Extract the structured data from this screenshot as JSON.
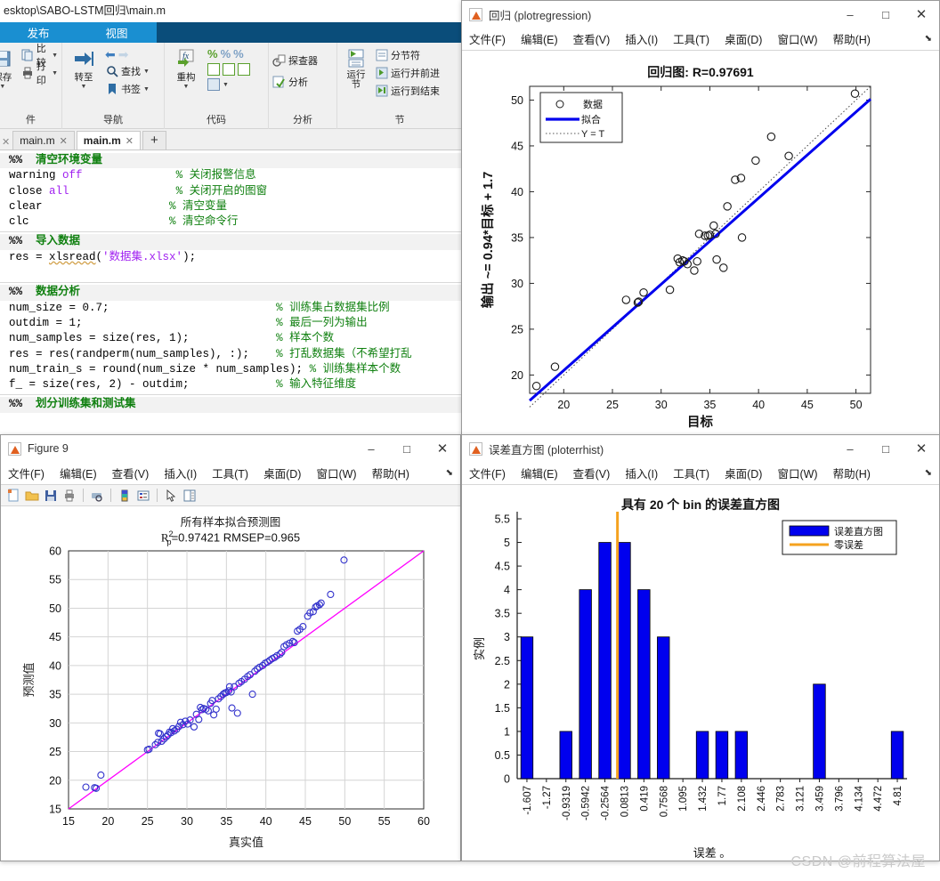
{
  "editor": {
    "path_title": "esktop\\SABO-LSTM回归\\main.m",
    "ribbon_tabs": [
      {
        "label": "发布"
      },
      {
        "label": "视图"
      }
    ],
    "ribbon_groups": [
      {
        "label": "件",
        "items": [
          "保存",
          "比较",
          "打印"
        ]
      },
      {
        "label": "导航",
        "items": [
          "转至",
          "查找",
          "书签"
        ]
      },
      {
        "label": "代码",
        "items": [
          "重构",
          "%",
          "%%",
          "%%↵"
        ]
      },
      {
        "label": "分析",
        "items": [
          "探查器",
          "分析"
        ]
      },
      {
        "label": "节",
        "items": [
          "运行节",
          "分节符",
          "运行并前进",
          "运行到结束"
        ]
      }
    ],
    "group_labels": {
      "file": "件",
      "nav": "导航",
      "code": "代码",
      "analyze": "分析",
      "section": "节"
    },
    "buttons": {
      "compare": "比较",
      "print": "打印",
      "goto": "转至",
      "find": "查找",
      "bookmark": "书签",
      "refactor": "重构",
      "profiler": "探查器",
      "analyze": "分析",
      "run_section": "运行\n节",
      "section_break": "分节符",
      "run_advance": "运行并前进",
      "run_to_end": "运行到结束"
    },
    "tabs": [
      {
        "label": "main.m",
        "active": false
      },
      {
        "label": "main.m",
        "active": true
      }
    ],
    "new_tab_label": "+",
    "code_lines": [
      {
        "type": "section",
        "text": "%%  清空环境变量"
      },
      {
        "type": "code",
        "code": "warning off",
        "comment": "% 关闭报警信息"
      },
      {
        "type": "code",
        "code": "close all",
        "comment": "% 关闭开启的图窗"
      },
      {
        "type": "code",
        "code": "clear",
        "comment": "% 清空变量"
      },
      {
        "type": "code",
        "code": "clc",
        "comment": "% 清空命令行"
      },
      {
        "type": "section",
        "text": "%%  导入数据"
      },
      {
        "type": "code",
        "code": "res = xlsread('数据集.xlsx');",
        "comment": ""
      },
      {
        "type": "blank"
      },
      {
        "type": "section",
        "text": "%%  数据分析"
      },
      {
        "type": "code",
        "code": "num_size = 0.7;",
        "comment": "% 训练集占数据集比例"
      },
      {
        "type": "code",
        "code": "outdim = 1;",
        "comment": "% 最后一列为输出"
      },
      {
        "type": "code",
        "code": "num_samples = size(res, 1);",
        "comment": "% 样本个数"
      },
      {
        "type": "code",
        "code": "res = res(randperm(num_samples), :);",
        "comment": "% 打乱数据集（不希望打乱"
      },
      {
        "type": "code",
        "code": "num_train_s = round(num_size * num_samples);",
        "comment": "% 训练集样本个数"
      },
      {
        "type": "code",
        "code": "f_ = size(res, 2) - outdim;",
        "comment": "% 输入特征维度"
      },
      {
        "type": "section",
        "text": "%%  划分训练集和测试集"
      }
    ]
  },
  "regression_window": {
    "title": "回归 (plotregression)",
    "menu": [
      {
        "label": "文件(F)"
      },
      {
        "label": "编辑(E)"
      },
      {
        "label": "查看(V)"
      },
      {
        "label": "插入(I)"
      },
      {
        "label": "工具(T)"
      },
      {
        "label": "桌面(D)"
      },
      {
        "label": "窗口(W)"
      },
      {
        "label": "帮助(H)"
      }
    ],
    "window_buttons": {
      "minimize": "–",
      "maximize": "□",
      "close": "✕"
    }
  },
  "figure9_window": {
    "title": "Figure 9",
    "menu": [
      {
        "label": "文件(F)"
      },
      {
        "label": "编辑(E)"
      },
      {
        "label": "查看(V)"
      },
      {
        "label": "插入(I)"
      },
      {
        "label": "工具(T)"
      },
      {
        "label": "桌面(D)"
      },
      {
        "label": "窗口(W)"
      },
      {
        "label": "帮助(H)"
      }
    ],
    "toolbar_icons": [
      "new-figure-icon",
      "open-file-icon",
      "save-icon",
      "print-icon",
      "print-preview-icon",
      "colorbar-icon",
      "legend-icon",
      "pointer-icon",
      "plot-browser-icon"
    ],
    "window_buttons": {
      "minimize": "–",
      "maximize": "□",
      "close": "✕"
    }
  },
  "errorhist_window": {
    "title": "误差直方图 (ploterrhist)",
    "menu": [
      {
        "label": "文件(F)"
      },
      {
        "label": "编辑(E)"
      },
      {
        "label": "查看(V)"
      },
      {
        "label": "插入(I)"
      },
      {
        "label": "工具(T)"
      },
      {
        "label": "桌面(D)"
      },
      {
        "label": "窗口(W)"
      },
      {
        "label": "帮助(H)"
      }
    ],
    "window_buttons": {
      "minimize": "–",
      "maximize": "□",
      "close": "✕"
    }
  },
  "watermark": "CSDN @前程算法屋",
  "chart_data": [
    {
      "id": "regression-plot",
      "type": "scatter",
      "title": "回归图: R=0.97691",
      "xlabel": "目标",
      "ylabel": "输出 ~= 0.94*目标 + 1.7",
      "xlim": [
        16.5,
        51.5
      ],
      "ylim": [
        18.0,
        51.5
      ],
      "xticks": [
        20,
        25,
        30,
        35,
        40,
        45,
        50
      ],
      "yticks": [
        20,
        25,
        30,
        35,
        40,
        45,
        50
      ],
      "grid": false,
      "legend": [
        {
          "label": "数据",
          "marker": "circle",
          "color": "#000000"
        },
        {
          "label": "拟合",
          "marker": "line",
          "color": "#0000ee"
        },
        {
          "label": "Y = T",
          "marker": "dotted",
          "color": "#555555"
        }
      ],
      "legend_position": "top-left",
      "fit_line": {
        "slope": 0.94,
        "intercept": 1.7,
        "color": "#0000ee"
      },
      "identity_line": {
        "slope": 1,
        "intercept": 0,
        "color": "#444444"
      },
      "points": [
        [
          17.2,
          18.8
        ],
        [
          19.1,
          20.9
        ],
        [
          26.4,
          28.2
        ],
        [
          27.6,
          27.9
        ],
        [
          27.7,
          28.0
        ],
        [
          28.2,
          29.0
        ],
        [
          30.9,
          29.3
        ],
        [
          31.7,
          32.7
        ],
        [
          31.9,
          32.3
        ],
        [
          32.4,
          32.4
        ],
        [
          32.7,
          32.1
        ],
        [
          33.4,
          31.4
        ],
        [
          33.7,
          32.4
        ],
        [
          34.8,
          35.2
        ],
        [
          35.0,
          35.3
        ],
        [
          35.4,
          36.3
        ],
        [
          35.6,
          35.4
        ],
        [
          35.7,
          32.6
        ],
        [
          36.4,
          31.7
        ],
        [
          38.3,
          35.0
        ],
        [
          36.8,
          38.4
        ],
        [
          37.6,
          41.3
        ],
        [
          38.2,
          41.5
        ],
        [
          39.7,
          43.4
        ],
        [
          41.3,
          46.0
        ],
        [
          43.1,
          43.9
        ],
        [
          49.9,
          50.7
        ],
        [
          33.9,
          35.4
        ],
        [
          34.5,
          35.2
        ],
        [
          32.2,
          32.5
        ]
      ]
    },
    {
      "id": "all-samples-fit-plot",
      "type": "scatter",
      "title": "所有样本拟合预测图",
      "subtitle": "R²p=0.97421  RMSEP=0.965",
      "subtitle_r2": "R",
      "subtitle_sup": "2",
      "subtitle_sub": "p",
      "subtitle_rest": "=0.97421  RMSEP=0.965",
      "xlabel": "真实值",
      "ylabel": "预测值",
      "xlim": [
        15,
        60
      ],
      "ylim": [
        15,
        60
      ],
      "xticks": [
        15,
        20,
        25,
        30,
        35,
        40,
        45,
        50,
        55,
        60
      ],
      "yticks": [
        15,
        20,
        25,
        30,
        35,
        40,
        45,
        50,
        55,
        60
      ],
      "grid": true,
      "identity_line": {
        "slope": 1,
        "intercept": 0,
        "color": "#ff00ff"
      },
      "marker_color": "#3333cc",
      "points": [
        [
          17.2,
          18.8
        ],
        [
          18.3,
          18.7
        ],
        [
          18.5,
          18.6
        ],
        [
          19.1,
          20.9
        ],
        [
          25.0,
          25.3
        ],
        [
          25.2,
          25.4
        ],
        [
          26.0,
          26.2
        ],
        [
          26.3,
          26.6
        ],
        [
          26.4,
          28.2
        ],
        [
          26.6,
          28.1
        ],
        [
          26.8,
          26.8
        ],
        [
          27.1,
          27.2
        ],
        [
          27.4,
          27.6
        ],
        [
          27.6,
          27.9
        ],
        [
          27.8,
          28.4
        ],
        [
          28.0,
          28.3
        ],
        [
          28.2,
          29.0
        ],
        [
          28.4,
          28.6
        ],
        [
          28.7,
          28.9
        ],
        [
          29.0,
          29.4
        ],
        [
          29.2,
          30.1
        ],
        [
          29.5,
          29.7
        ],
        [
          29.8,
          30.3
        ],
        [
          30.1,
          29.8
        ],
        [
          30.4,
          30.5
        ],
        [
          30.9,
          29.3
        ],
        [
          31.2,
          31.5
        ],
        [
          31.5,
          30.6
        ],
        [
          31.7,
          32.7
        ],
        [
          31.9,
          32.3
        ],
        [
          32.1,
          32.5
        ],
        [
          32.4,
          32.4
        ],
        [
          32.7,
          32.1
        ],
        [
          33.0,
          33.4
        ],
        [
          33.2,
          33.9
        ],
        [
          33.4,
          31.4
        ],
        [
          33.7,
          32.4
        ],
        [
          34.0,
          34.2
        ],
        [
          34.3,
          34.6
        ],
        [
          34.6,
          35.0
        ],
        [
          34.8,
          35.2
        ],
        [
          35.0,
          35.3
        ],
        [
          35.3,
          35.6
        ],
        [
          35.4,
          36.3
        ],
        [
          35.6,
          35.4
        ],
        [
          35.7,
          32.6
        ],
        [
          36.0,
          36.3
        ],
        [
          36.4,
          31.7
        ],
        [
          36.6,
          36.9
        ],
        [
          36.9,
          37.2
        ],
        [
          37.3,
          37.6
        ],
        [
          37.7,
          38.1
        ],
        [
          38.0,
          38.4
        ],
        [
          38.3,
          35.0
        ],
        [
          38.6,
          39.0
        ],
        [
          38.9,
          39.4
        ],
        [
          39.2,
          39.7
        ],
        [
          39.6,
          40.0
        ],
        [
          39.9,
          40.4
        ],
        [
          40.2,
          40.6
        ],
        [
          40.5,
          40.9
        ],
        [
          40.8,
          41.2
        ],
        [
          41.1,
          41.4
        ],
        [
          41.4,
          41.7
        ],
        [
          41.8,
          42.0
        ],
        [
          42.0,
          42.3
        ],
        [
          42.3,
          43.3
        ],
        [
          42.6,
          43.6
        ],
        [
          43.0,
          43.9
        ],
        [
          43.4,
          44.2
        ],
        [
          43.6,
          44.0
        ],
        [
          44.0,
          46.0
        ],
        [
          44.3,
          46.3
        ],
        [
          44.7,
          46.8
        ],
        [
          45.3,
          48.6
        ],
        [
          45.6,
          49.2
        ],
        [
          46.0,
          49.4
        ],
        [
          46.3,
          50.2
        ],
        [
          46.5,
          50.4
        ],
        [
          46.8,
          50.6
        ],
        [
          47.0,
          50.9
        ],
        [
          48.2,
          52.4
        ],
        [
          49.9,
          58.4
        ]
      ]
    },
    {
      "id": "error-histogram",
      "type": "bar",
      "title": "具有 20 个 bin 的误差直方图",
      "xlabel": "误差 。",
      "ylabel": "实例",
      "categories": [
        "-1.607",
        "-1.27",
        "-0.9319",
        "-0.5942",
        "-0.2564",
        "0.0813",
        "0.419",
        "0.7568",
        "1.095",
        "1.432",
        "1.77",
        "2.108",
        "2.446",
        "2.783",
        "3.121",
        "3.459",
        "3.796",
        "4.134",
        "4.472",
        "4.81"
      ],
      "values": [
        3,
        0,
        1,
        4,
        5,
        5,
        4,
        3,
        0,
        1,
        1,
        1,
        0,
        0,
        0,
        2,
        0,
        0,
        0,
        1
      ],
      "ylim": [
        0,
        5.5
      ],
      "yticks": [
        0,
        0.5,
        1,
        1.5,
        2,
        2.5,
        3,
        3.5,
        4,
        4.5,
        5,
        5.5
      ],
      "bar_color": "#0000ee",
      "zero_error_color": "#f5a21e",
      "zero_error_bin_index": 5,
      "legend": [
        {
          "label": "误差直方图",
          "color": "#0000ee",
          "marker": "patch"
        },
        {
          "label": "零误差",
          "color": "#f5a21e",
          "marker": "line"
        }
      ],
      "legend_position": "top-right",
      "bin_count": 20
    }
  ]
}
